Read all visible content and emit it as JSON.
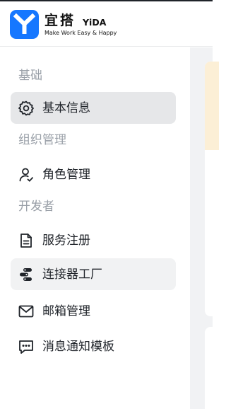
{
  "brand": {
    "name_cn": "宜搭",
    "name_en": "YiDA",
    "tagline": "Make Work Easy & Happy",
    "color": "#1677ff"
  },
  "sidebar": {
    "groups": [
      {
        "title": "基础",
        "items": [
          {
            "label": "基本信息",
            "icon": "gear-icon",
            "state": "active"
          }
        ]
      },
      {
        "title": "组织管理",
        "items": [
          {
            "label": "角色管理",
            "icon": "user-role-icon",
            "state": "normal"
          }
        ]
      },
      {
        "title": "开发者",
        "items": [
          {
            "label": "服务注册",
            "icon": "document-icon",
            "state": "normal"
          },
          {
            "label": "连接器工厂",
            "icon": "connector-icon",
            "state": "hover"
          },
          {
            "label": "邮箱管理",
            "icon": "mail-icon",
            "state": "normal"
          },
          {
            "label": "消息通知模板",
            "icon": "message-icon",
            "state": "normal"
          }
        ]
      }
    ]
  },
  "colors": {
    "active_bg": "#e6e7e9",
    "hover_bg": "#f1f2f3",
    "group_title": "#9aa0a8",
    "banner": "#fcefd6"
  }
}
